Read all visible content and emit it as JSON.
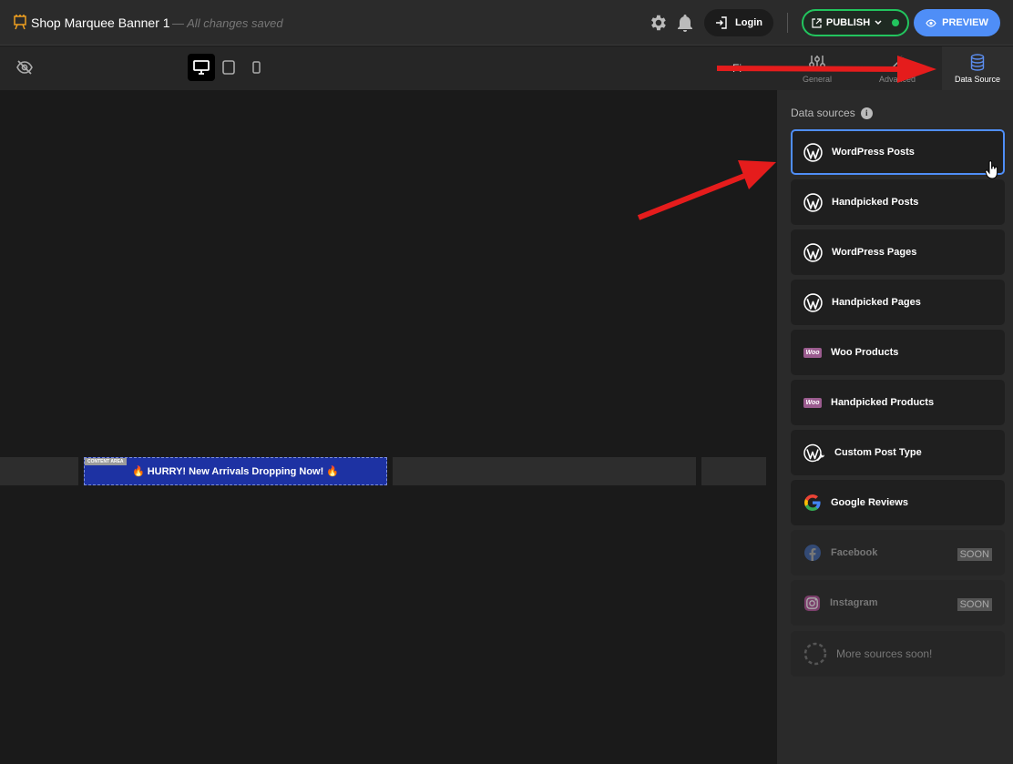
{
  "header": {
    "app_title": "Shop Marquee Banner 1",
    "save_status": "— All changes saved",
    "login_label": "Login",
    "publish_label": "PUBLISH",
    "preview_label": "PREVIEW",
    "publish_status_color": "#22c55e",
    "accent_color": "#4f8ef7"
  },
  "toolbar": {
    "devices": [
      "desktop",
      "tablet",
      "mobile"
    ],
    "active_device": "desktop",
    "truncated_tab_text": "Fi",
    "tabs": [
      {
        "label": "General",
        "icon": "sliders-icon"
      },
      {
        "label": "Advanced",
        "icon": "wrench-icon"
      },
      {
        "label": "Data Source",
        "icon": "database-icon"
      }
    ],
    "active_tab": "Data Source"
  },
  "canvas": {
    "content_area_tag": "CONTENT AREA",
    "banner_text": "🔥 HURRY! New Arrivals Dropping Now! 🔥",
    "banner_color": "#1d32a3"
  },
  "panel": {
    "title": "Data sources",
    "sources": [
      {
        "label": "WordPress Posts",
        "icon": "wordpress-icon",
        "state": "selected"
      },
      {
        "label": "Handpicked Posts",
        "icon": "wordpress-icon",
        "state": "normal"
      },
      {
        "label": "WordPress Pages",
        "icon": "wordpress-icon",
        "state": "normal"
      },
      {
        "label": "Handpicked Pages",
        "icon": "wordpress-icon",
        "state": "normal"
      },
      {
        "label": "Woo Products",
        "icon": "woo-icon",
        "state": "normal"
      },
      {
        "label": "Handpicked Products",
        "icon": "woo-icon",
        "state": "normal"
      },
      {
        "label": "Custom Post Type",
        "icon": "wordpress-wrench-icon",
        "state": "normal"
      },
      {
        "label": "Google Reviews",
        "icon": "google-icon",
        "state": "normal"
      },
      {
        "label": "Facebook",
        "icon": "facebook-icon",
        "state": "disabled",
        "badge": "SOON"
      },
      {
        "label": "Instagram",
        "icon": "instagram-icon",
        "state": "disabled",
        "badge": "SOON"
      },
      {
        "label": "More sources soon!",
        "icon": "dashed-circle-icon",
        "state": "placeholder"
      }
    ],
    "woo_badge_text": "Woo"
  }
}
